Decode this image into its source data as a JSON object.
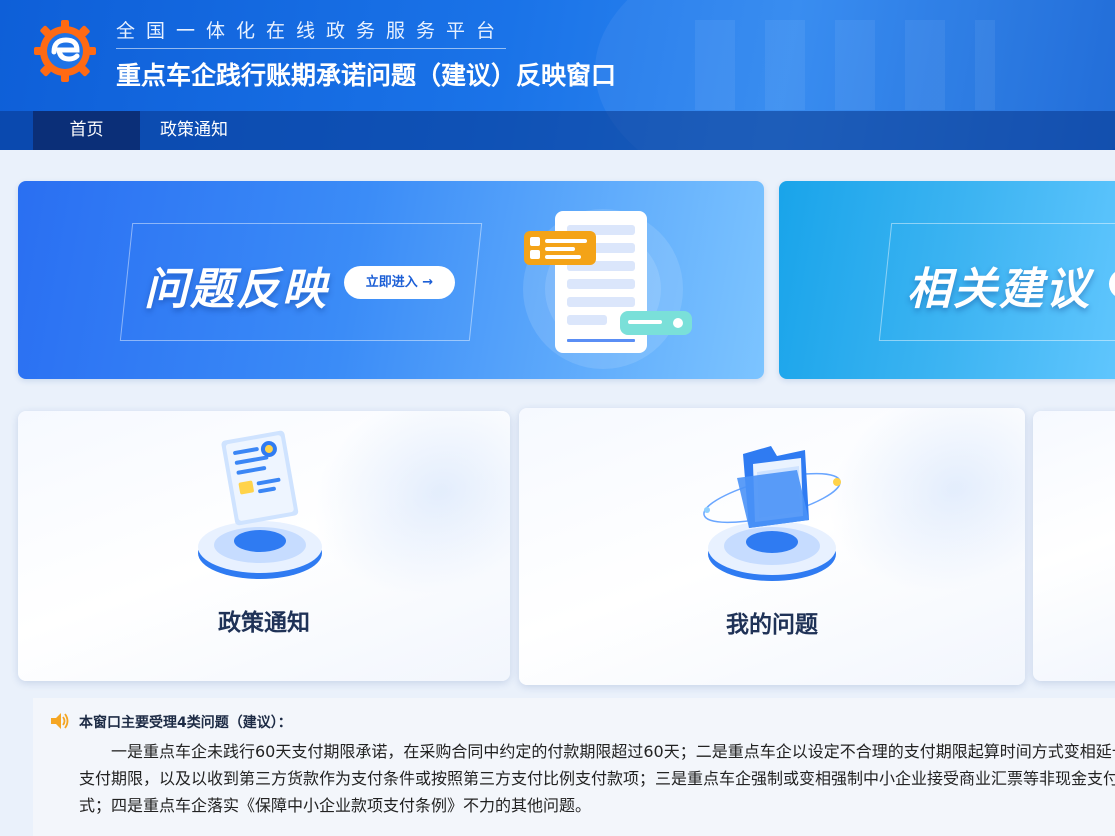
{
  "header": {
    "platform_name": "全国一体化在线政务服务平台",
    "window_title": "重点车企践行账期承诺问题（建议）反映窗口",
    "logo_icon": "platform-logo-icon"
  },
  "nav": {
    "items": [
      {
        "label": "首页",
        "active": true
      },
      {
        "label": "政策通知",
        "active": false
      }
    ]
  },
  "banners": [
    {
      "title": "问题反映",
      "button_label": "立即进入 →",
      "illustration": "document-chat-icon"
    },
    {
      "title": "相关建议"
    }
  ],
  "cards": [
    {
      "label": "政策通知",
      "illustration": "certificate-icon"
    },
    {
      "label": "我的问题",
      "illustration": "folder-icon"
    },
    {
      "label": ""
    }
  ],
  "notice": {
    "icon": "speaker-icon",
    "heading": "本窗口主要受理4类问题（建议）：",
    "body": "一是重点车企未践行60天支付期限承诺，在采购合同中约定的付款期限超过60天；二是重点车企以设定不合理的支付期限起算时间方式变相延长支付期限，以及以收到第三方货款作为支付条件或按照第三方支付比例支付款项；三是重点车企强制或变相强制中小企业接受商业汇票等非现金支付方式；四是重点车企落实《保障中小企业款项支付条例》不力的其他问题。"
  },
  "colors": {
    "header_blue": "#1a73e8",
    "nav_active": "#0b2f78",
    "accent_orange": "#f5a623"
  }
}
